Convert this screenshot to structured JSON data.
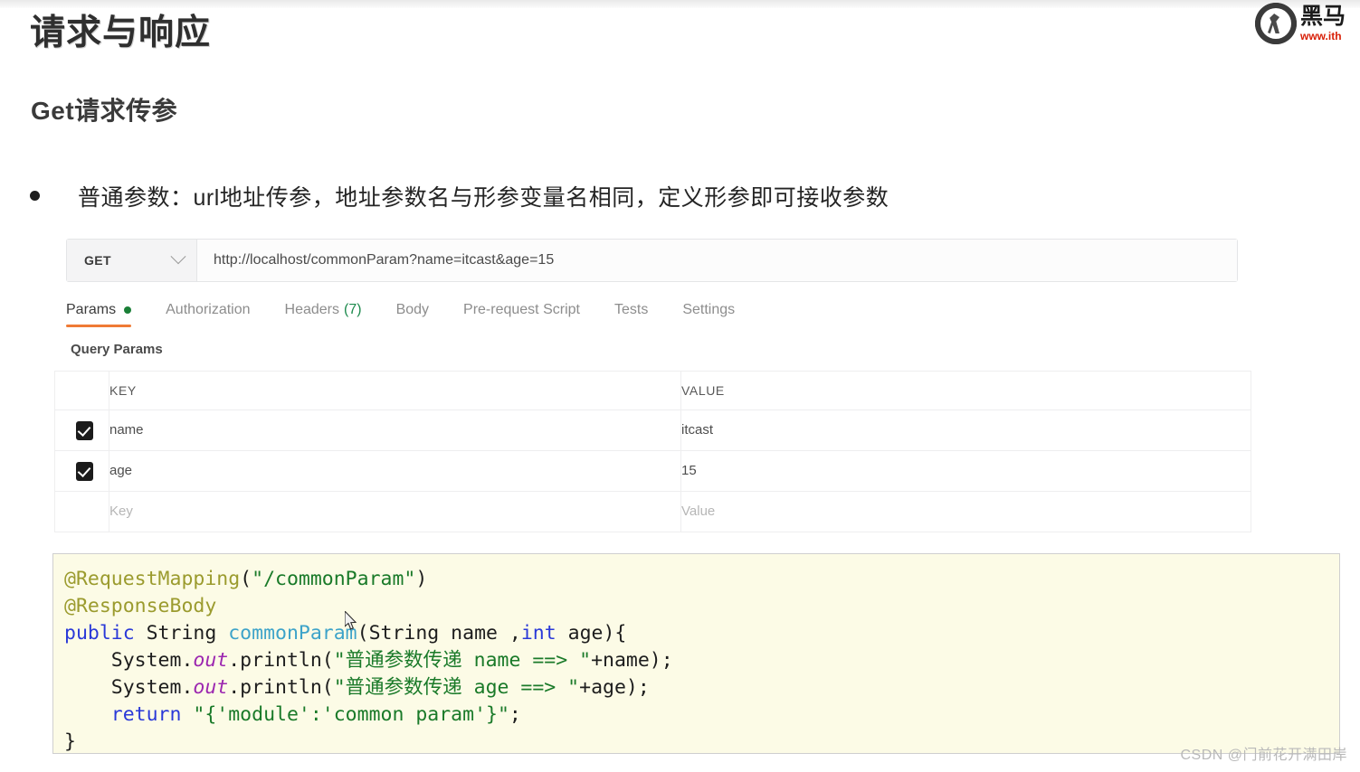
{
  "brand": {
    "logo_icon": "horse-head-logo-icon",
    "name_cn": "黑马",
    "url": "www.ith"
  },
  "page": {
    "title": "请求与响应",
    "section_title": "Get请求传参",
    "bullet": "普通参数：url地址传参，地址参数名与形参变量名相同，定义形参即可接收参数"
  },
  "postman": {
    "method": "GET",
    "method_chevron_icon": "chevron-down-icon",
    "url": "http://localhost/commonParam?name=itcast&age=15",
    "tabs": [
      {
        "label": "Params",
        "active": true,
        "dot": true
      },
      {
        "label": "Authorization",
        "active": false
      },
      {
        "label": "Headers",
        "active": false,
        "count": "(7)"
      },
      {
        "label": "Body",
        "active": false
      },
      {
        "label": "Pre-request Script",
        "active": false
      },
      {
        "label": "Tests",
        "active": false
      },
      {
        "label": "Settings",
        "active": false
      }
    ],
    "params_subheading": "Query Params",
    "table": {
      "headers": {
        "key": "KEY",
        "value": "VALUE"
      },
      "rows": [
        {
          "checked": true,
          "key": "name",
          "value": "itcast"
        },
        {
          "checked": true,
          "key": "age",
          "value": "15"
        }
      ],
      "placeholder_row": {
        "key": "Key",
        "value": "Value"
      }
    }
  },
  "code": {
    "lines": [
      [
        {
          "t": "@RequestMapping",
          "c": "ann"
        },
        {
          "t": "(",
          "c": "plain"
        },
        {
          "t": "\"/commonParam\"",
          "c": "str"
        },
        {
          "t": ")",
          "c": "plain"
        }
      ],
      [
        {
          "t": "@ResponseBody",
          "c": "ann"
        }
      ],
      [
        {
          "t": "public",
          "c": "kw"
        },
        {
          "t": " String ",
          "c": "plain"
        },
        {
          "t": "commonParam",
          "c": "method"
        },
        {
          "t": "(String name ,",
          "c": "plain"
        },
        {
          "t": "int",
          "c": "kw"
        },
        {
          "t": " age){",
          "c": "plain"
        }
      ],
      [
        {
          "t": "    System.",
          "c": "plain"
        },
        {
          "t": "out",
          "c": "field"
        },
        {
          "t": ".println(",
          "c": "plain"
        },
        {
          "t": "\"普通参数传递 name ==> \"",
          "c": "str"
        },
        {
          "t": "+name);",
          "c": "plain"
        }
      ],
      [
        {
          "t": "    System.",
          "c": "plain"
        },
        {
          "t": "out",
          "c": "field"
        },
        {
          "t": ".println(",
          "c": "plain"
        },
        {
          "t": "\"普通参数传递 age ==> \"",
          "c": "str"
        },
        {
          "t": "+age);",
          "c": "plain"
        }
      ],
      [
        {
          "t": "    ",
          "c": "plain"
        },
        {
          "t": "return",
          "c": "kw"
        },
        {
          "t": " ",
          "c": "plain"
        },
        {
          "t": "\"{'module':'common param'}\"",
          "c": "str"
        },
        {
          "t": ";",
          "c": "plain"
        }
      ],
      [
        {
          "t": "}",
          "c": "plain"
        }
      ]
    ]
  },
  "watermark": "CSDN @门前花开满田岸",
  "colors": {
    "accent_orange": "#ef7a35",
    "dot_green": "#1a7f37",
    "code_bg": "#fcfbe6",
    "brand_red": "#d81e06",
    "keyword_blue": "#2a39d8",
    "string_green": "#1a7a29",
    "annotation_olive": "#9b9b2e",
    "method_cyan": "#3da3c9",
    "field_purple": "#9c27b0"
  }
}
